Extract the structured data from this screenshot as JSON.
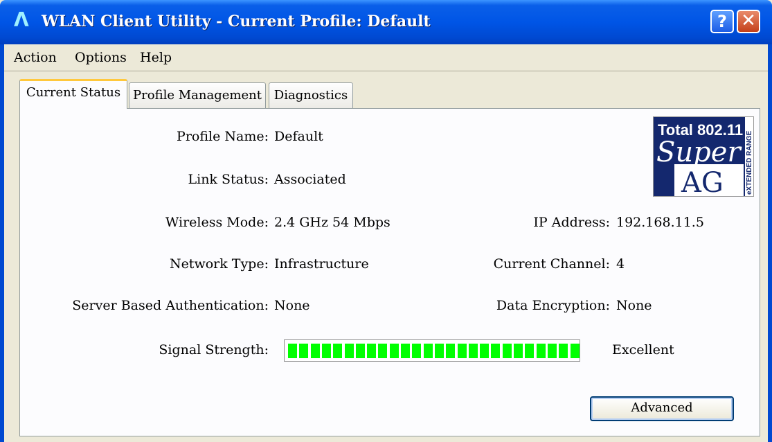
{
  "window": {
    "title": "WLAN Client Utility - Current Profile: Default",
    "help_glyph": "?",
    "close_glyph": "✕",
    "title_icon_glyph": "Λ"
  },
  "menu": {
    "items": [
      "Action",
      "Options",
      "Help"
    ]
  },
  "tabs": [
    "Current Status",
    "Profile Management",
    "Diagnostics"
  ],
  "status": {
    "profile_name_label": "Profile Name:",
    "profile_name": "Default",
    "link_status_label": "Link Status:",
    "link_status": "Associated",
    "wireless_mode_label": "Wireless Mode:",
    "wireless_mode": "2.4 GHz 54 Mbps",
    "network_type_label": "Network Type:",
    "network_type": "Infrastructure",
    "server_auth_label": "Server Based Authentication:",
    "server_auth": "None",
    "ip_label": "IP Address:",
    "ip": "192.168.11.5",
    "channel_label": "Current Channel:",
    "channel": "4",
    "encryption_label": "Data Encryption:",
    "encryption": "None",
    "signal_label": "Signal Strength:",
    "signal_text": "Excellent",
    "signal_level": 1.0
  },
  "logo": {
    "line1": "Total 802.11",
    "line2": "Super",
    "line3": "AG",
    "side": "eXTENDED RANGE"
  },
  "advanced_button": "Advanced",
  "colors": {
    "titlebar": "#0055e6",
    "signal": "#00ff00",
    "tab_highlight": "#ffc83c"
  }
}
